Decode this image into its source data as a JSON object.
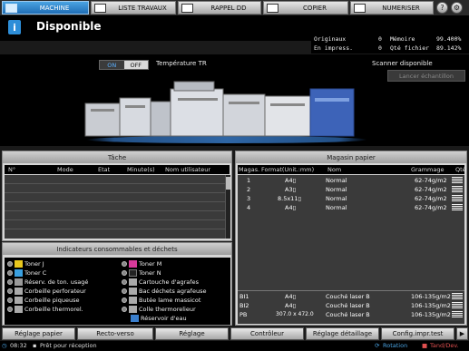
{
  "tabs": {
    "machine": "MACHINE",
    "jobs": "LISTE TRAVAUX",
    "recall": "RAPPEL DD",
    "copy": "COPIER",
    "scan": "NUMERISER"
  },
  "header": {
    "status": "Disponible",
    "info_icon": "i"
  },
  "counters": {
    "originals_label": "Originaux",
    "originals_value": "0",
    "printing_label": "En impress.",
    "printing_value": "0",
    "memory_label": "Mémoire",
    "memory_value": "99.400%",
    "file_qty_label": "Qté fichier",
    "file_qty_value": "89.142%"
  },
  "machine": {
    "toggle_on": "ON",
    "toggle_off": "OFF",
    "temperature_label": "Température TR",
    "scanner_status": "Scanner disponible",
    "sample_button": "Lancer échantillon"
  },
  "tasks": {
    "title": "Tâche",
    "columns": [
      "N°",
      "Mode",
      "Etat",
      "Minute(s)",
      "Nom utilisateur"
    ]
  },
  "consumables": {
    "title": "Indicateurs consommables et déchets",
    "left": [
      {
        "label": "Toner J",
        "color": "#e8c81e"
      },
      {
        "label": "Toner C",
        "color": "#3aa0e0"
      },
      {
        "label": "Réserv. de ton. usagé",
        "color": "#888888"
      },
      {
        "label": "Corbeille perforateur",
        "color": "#888888"
      },
      {
        "label": "Corbeille piqueuse",
        "color": "#888888"
      },
      {
        "label": "Corbeille thermorel.",
        "color": "#888888"
      }
    ],
    "right": [
      {
        "label": "Toner M",
        "color": "#d83a9a"
      },
      {
        "label": "Toner N",
        "color": "#333333"
      },
      {
        "label": "Cartouche d'agrafes",
        "color": "#888888"
      },
      {
        "label": "Bac déchets agrafeuse",
        "color": "#888888"
      },
      {
        "label": "Butée lame massicot",
        "color": "#888888"
      },
      {
        "label": "Colle thermorelieur",
        "color": "#888888"
      },
      {
        "label": "Réservoir d'eau",
        "color": "#3a7fce"
      }
    ]
  },
  "paper": {
    "title": "Magasin papier",
    "columns": [
      "Magas.",
      "Format(Unit.:mm)",
      "Nom",
      "Grammage",
      "Qté"
    ],
    "rows": [
      {
        "tray": "1",
        "format": "A4▯",
        "name": "Normal",
        "weight": "62-74g/m2"
      },
      {
        "tray": "2",
        "format": "A3▯",
        "name": "Normal",
        "weight": "62-74g/m2"
      },
      {
        "tray": "3",
        "format": "8.5x11▯",
        "name": "Normal",
        "weight": "62-74g/m2"
      },
      {
        "tray": "4",
        "format": "A4▯",
        "name": "Normal",
        "weight": "62-74g/m2"
      }
    ],
    "bypass_rows": [
      {
        "tray": "BI1",
        "format": "A4▯",
        "name": "Couché laser B",
        "weight": "106-135g/m2"
      },
      {
        "tray": "BI2",
        "format": "A4▯",
        "name": "Couché laser B",
        "weight": "106-135g/m2"
      },
      {
        "tray": "PB",
        "format": "307.0 x 472.0",
        "name": "Couché laser B",
        "weight": "106-135g/m2"
      }
    ]
  },
  "bottom_buttons": [
    "Réglage papier",
    "Recto-verso",
    "Réglage",
    "Contrôleur",
    "Réglage détaillage",
    "Config.impr.test"
  ],
  "status_bar": {
    "time": "08:32",
    "message": "Prêt pour réception",
    "rotation": "Rotation",
    "tandem": "Tand/Dev."
  }
}
